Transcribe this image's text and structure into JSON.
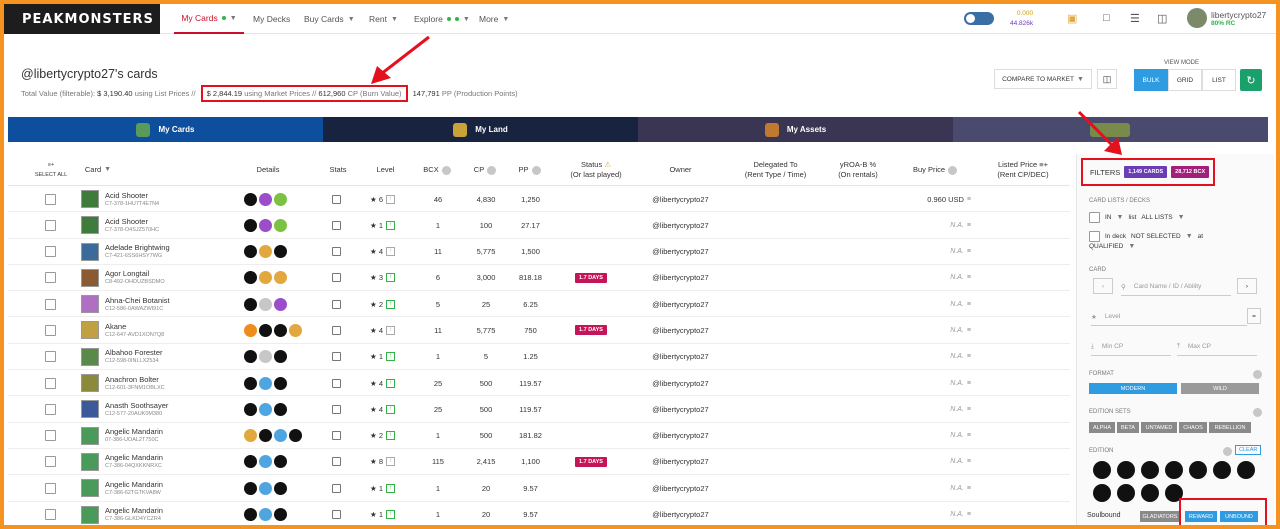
{
  "nav": {
    "logo": "PEAKMONSTERS",
    "items": [
      {
        "label": "My Cards",
        "dot": true,
        "chevron": true,
        "active": true
      },
      {
        "label": "My Decks"
      },
      {
        "label": "Buy Cards",
        "chevron": true
      },
      {
        "label": "Rent",
        "chevron": true
      },
      {
        "label": "Explore",
        "dot": true,
        "chevron": true
      },
      {
        "label": "More",
        "chevron": true
      }
    ],
    "balance_top": "0.000",
    "balance_bottom": "44.826k",
    "username": "libertycrypto27",
    "rc": "80% RC"
  },
  "header": {
    "title": "@libertycrypto27's cards",
    "total_label": "Total Value (filterable):",
    "list_value": "$ 3,190.40",
    "list_suffix": "using List Prices //",
    "market_value": "$ 2,844.19",
    "market_suffix": "using Market Prices //",
    "cp_value": "612,960",
    "cp_suffix": "CP (Burn Value)",
    "pp_value": "147,791",
    "pp_suffix": "PP (Production Points)",
    "compare_label": "COMPARE TO MARKET",
    "view_mode_label": "VIEW MODE",
    "view_modes": [
      "BULK",
      "GRID",
      "LIST"
    ],
    "active_view": "BULK"
  },
  "section_tabs": [
    {
      "label": "My Cards",
      "color": "#0d4f9c"
    },
    {
      "label": "My Land",
      "color": "#18233f"
    },
    {
      "label": "My Assets",
      "color": "#3a3552"
    },
    {
      "label": "",
      "color": "#4a4a6e"
    }
  ],
  "table": {
    "select_all": "SELECT ALL",
    "headers": {
      "card": "Card",
      "details": "Details",
      "stats": "Stats",
      "level": "Level",
      "bcx": "BCX",
      "cp": "CP",
      "pp": "PP",
      "status": "Status",
      "status_sub": "(Or last played)",
      "owner": "Owner",
      "delegated": "Delegated To",
      "delegated_sub": "(Rent Type / Time)",
      "yroa": "yROA-B %",
      "yroa_sub": "(On rentals)",
      "buy_price": "Buy Price",
      "listed_price": "Listed Price",
      "listed_sub": "(Rent CP/DEC)"
    },
    "rows": [
      {
        "name": "Acid Shooter",
        "id": "C7-378-1HU7T4E7N4",
        "icons": [
          "blk",
          "pur",
          "grn"
        ],
        "level": "6",
        "up": false,
        "bcx": "46",
        "cp": "4,830",
        "pp": "1,250",
        "status": "",
        "owner": "@libertycrypto27",
        "buy": "0.960 USD",
        "thumb": "#3f7b3a"
      },
      {
        "name": "Acid Shooter",
        "id": "C7-378-O4SJZ570HC",
        "icons": [
          "blk",
          "pur",
          "grn"
        ],
        "level": "1",
        "up": true,
        "bcx": "1",
        "cp": "100",
        "pp": "27.17",
        "status": "",
        "owner": "@libertycrypto27",
        "buy": "N.A.",
        "thumb": "#3f7b3a"
      },
      {
        "name": "Adelade Brightwing",
        "id": "C7-421-6SS6HSY7WG",
        "icons": [
          "blk",
          "gld",
          "blk"
        ],
        "level": "4",
        "up": false,
        "bcx": "11",
        "cp": "5,775",
        "pp": "1,500",
        "status": "",
        "owner": "@libertycrypto27",
        "buy": "N.A.",
        "thumb": "#3a6b9a"
      },
      {
        "name": "Agor Longtail",
        "id": "C8-492-OHDUZBSDMO",
        "icons": [
          "blk",
          "gld",
          "gld"
        ],
        "level": "3",
        "up": true,
        "bcx": "6",
        "cp": "3,000",
        "pp": "818.18",
        "status": "1.7 DAYS",
        "owner": "@libertycrypto27",
        "buy": "N.A.",
        "thumb": "#8a5a30"
      },
      {
        "name": "Ahna-Chei Botanist",
        "id": "C12-586-0AWAZWI91C",
        "icons": [
          "blk",
          "gry",
          "pur"
        ],
        "level": "2",
        "up": true,
        "bcx": "5",
        "cp": "25",
        "pp": "6.25",
        "status": "",
        "owner": "@libertycrypto27",
        "buy": "N.A.",
        "thumb": "#b070c0"
      },
      {
        "name": "Akane",
        "id": "C12-647-AVD1XON7Q8",
        "icons": [
          "ora",
          "blk",
          "blk",
          "gld"
        ],
        "level": "4",
        "up": false,
        "bcx": "11",
        "cp": "5,775",
        "pp": "750",
        "status": "1.7 DAYS",
        "owner": "@libertycrypto27",
        "buy": "N.A.",
        "thumb": "#c0a040"
      },
      {
        "name": "Albahoo Forester",
        "id": "C12-598-0INLLX2534",
        "icons": [
          "blk",
          "gry",
          "blk"
        ],
        "level": "1",
        "up": true,
        "bcx": "1",
        "cp": "5",
        "pp": "1.25",
        "status": "",
        "owner": "@libertycrypto27",
        "buy": "N.A.",
        "thumb": "#5a8a4a"
      },
      {
        "name": "Anachron Bolter",
        "id": "C12-601-3FNM1OBLXC",
        "icons": [
          "blk",
          "blu",
          "blk"
        ],
        "level": "4",
        "up": true,
        "bcx": "25",
        "cp": "500",
        "pp": "119.57",
        "status": "",
        "owner": "@libertycrypto27",
        "buy": "N.A.",
        "thumb": "#8a8a3a"
      },
      {
        "name": "Anasth Soothsayer",
        "id": "C12-577-20AUK0M380",
        "icons": [
          "blk",
          "blu",
          "blk"
        ],
        "level": "4",
        "up": true,
        "bcx": "25",
        "cp": "500",
        "pp": "119.57",
        "status": "",
        "owner": "@libertycrypto27",
        "buy": "N.A.",
        "thumb": "#3a5a9a"
      },
      {
        "name": "Angelic Mandarin",
        "id": "07-386-UOAL2T750C",
        "icons": [
          "gld",
          "blk",
          "blu",
          "blk"
        ],
        "level": "2",
        "up": true,
        "bcx": "1",
        "cp": "500",
        "pp": "181.82",
        "status": "",
        "owner": "@libertycrypto27",
        "buy": "N.A.",
        "thumb": "#4a9a5a"
      },
      {
        "name": "Angelic Mandarin",
        "id": "C7-386-04QXKKNRXC",
        "icons": [
          "blk",
          "blu",
          "blk"
        ],
        "level": "8",
        "up": false,
        "bcx": "115",
        "cp": "2,415",
        "pp": "1,100",
        "status": "1.7 DAYS",
        "owner": "@libertycrypto27",
        "buy": "N.A.",
        "thumb": "#4a9a5a"
      },
      {
        "name": "Angelic Mandarin",
        "id": "C7-386-62TGTKVA8W",
        "icons": [
          "blk",
          "blu",
          "blk"
        ],
        "level": "1",
        "up": true,
        "bcx": "1",
        "cp": "20",
        "pp": "9.57",
        "status": "",
        "owner": "@libertycrypto27",
        "buy": "N.A.",
        "thumb": "#4a9a5a"
      },
      {
        "name": "Angelic Mandarin",
        "id": "C7-386-GLKD4YCZR4",
        "icons": [
          "blk",
          "blu",
          "blk"
        ],
        "level": "1",
        "up": true,
        "bcx": "1",
        "cp": "20",
        "pp": "9.57",
        "status": "",
        "owner": "@libertycrypto27",
        "buy": "N.A.",
        "thumb": "#4a9a5a"
      }
    ]
  },
  "filters": {
    "title": "FILTERS",
    "cards_count": "1,149 CARDS",
    "bcx_count": "28,712 BCX",
    "card_lists_label": "CARD LISTS / DECKS",
    "in_label": "IN",
    "list_label": "list",
    "all_lists": "ALL LISTS",
    "in_deck_label": "In deck",
    "not_selected": "NOT SELECTED",
    "at_label": "at",
    "qualified": "QUALIFIED",
    "card_label": "CARD",
    "card_search_placeholder": "Card Name / ID / Ability",
    "level_placeholder": "Level",
    "eq_label": "=",
    "min_cp": "Min CP",
    "max_cp": "Max CP",
    "format_label": "FORMAT",
    "modern": "MODERN",
    "wild": "WILD",
    "edition_sets_label": "EDITION SETS",
    "sets": [
      "ALPHA",
      "BETA",
      "UNTAMED",
      "CHAOS",
      "REBELLION"
    ],
    "edition_label": "EDITION",
    "clear": "CLEAR",
    "soulbound_label": "Soulbound",
    "gladiators": "GLADIATORS",
    "reward": "REWARD",
    "unbound": "UNBOUND"
  }
}
